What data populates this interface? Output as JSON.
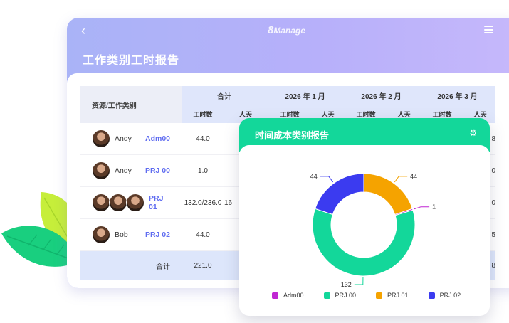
{
  "header": {
    "back_icon": "chevron-left-icon",
    "logo_prefix": "8",
    "logo_text": "Manage",
    "menu_icon": "hamburger-menu-icon"
  },
  "page_title": "工作类别工时报告",
  "table": {
    "resource_header": "资源/工作类别",
    "groups": [
      "合计",
      "2026 年 1 月",
      "2026 年 2 月",
      "2026 年 3 月"
    ],
    "sub_headers": [
      "工时数",
      "人天",
      "工时数",
      "人天",
      "工时数",
      "人天",
      "工时数",
      "人天"
    ],
    "rows": [
      {
        "name": "Andy",
        "category": "Adm00",
        "hours": "44.0",
        "partial_mid": "",
        "edge": "8"
      },
      {
        "name": "Andy",
        "category": "PRJ 00",
        "hours": "1.0",
        "partial_mid": "",
        "edge": "0"
      },
      {
        "name": "",
        "category": "PRJ 01",
        "hours": "132.0/236.0",
        "partial_mid": "16",
        "edge": "0"
      },
      {
        "name": "Bob",
        "category": "PRJ 02",
        "hours": "44.0",
        "partial_mid": "",
        "edge": "5"
      }
    ],
    "total_label": "合计",
    "total_hours": "221.0",
    "total_edge": "8"
  },
  "popup": {
    "title": "时间成本类别报告",
    "settings_icon": "gear-icon",
    "legend": [
      {
        "label": "Adm00",
        "color": "#c026d3"
      },
      {
        "label": "PRJ 00",
        "color": "#13d79a"
      },
      {
        "label": "PRJ 01",
        "color": "#f5a300"
      },
      {
        "label": "PRJ 02",
        "color": "#3b3bf0"
      }
    ]
  },
  "chart_data": {
    "type": "pie",
    "donut": true,
    "categories": [
      "Adm00",
      "PRJ 00",
      "PRJ 01",
      "PRJ 02"
    ],
    "values": [
      1,
      132,
      44,
      44
    ],
    "colors": [
      "#c026d3",
      "#13d79a",
      "#f5a300",
      "#3b3bf0"
    ],
    "data_labels": [
      "1",
      "132",
      "44",
      "44"
    ],
    "legend_position": "bottom"
  }
}
